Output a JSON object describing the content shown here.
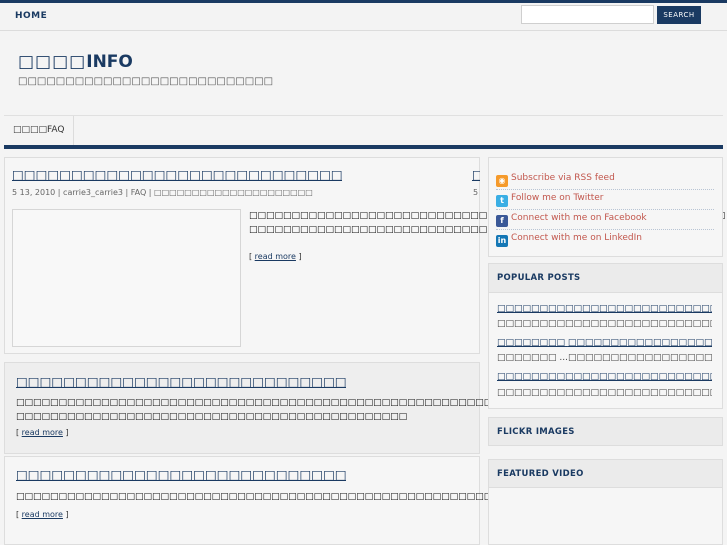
{
  "topnav": {
    "home": "HOME"
  },
  "search": {
    "placeholder": "",
    "button": "SEARCH"
  },
  "site": {
    "title": "INFO",
    "description": ""
  },
  "catnav": {
    "item": "FAQ"
  },
  "posts": [
    {
      "title": "....",
      "meta": "5 13, 2010 | carrie3_carrie3 | FAQ | ",
      "excerpt": " ",
      "read_more": "read more"
    },
    {
      "title": "....",
      "excerpt": " ",
      "read_more": "read more"
    },
    {
      "title": "....",
      "excerpt": "",
      "read_more": "read more"
    }
  ],
  "partial_post": {
    "title_fragment": "",
    "meta_fragment": "5"
  },
  "sidebar": {
    "social": [
      {
        "label": "Subscribe via RSS feed",
        "icon": "rss-icon"
      },
      {
        "label": "Follow me on Twitter",
        "icon": "twitter-icon"
      },
      {
        "label": "Connect with me on Facebook",
        "icon": "facebook-icon"
      },
      {
        "label": "Connect with me on LinkedIn",
        "icon": "linkedin-icon"
      }
    ],
    "popular_heading": "POPULAR POSTS",
    "popular": [
      {
        "title": "....",
        "excerpt": "..."
      },
      {
        "title": " ",
        "excerpt": "  ..."
      },
      {
        "title": "",
        "excerpt": "..."
      }
    ],
    "flickr_heading": "FLICKR IMAGES",
    "video_heading": "FEATURED VIDEO"
  },
  "colors": {
    "primary": "#1a3a62",
    "link_social": "#c2574d"
  }
}
